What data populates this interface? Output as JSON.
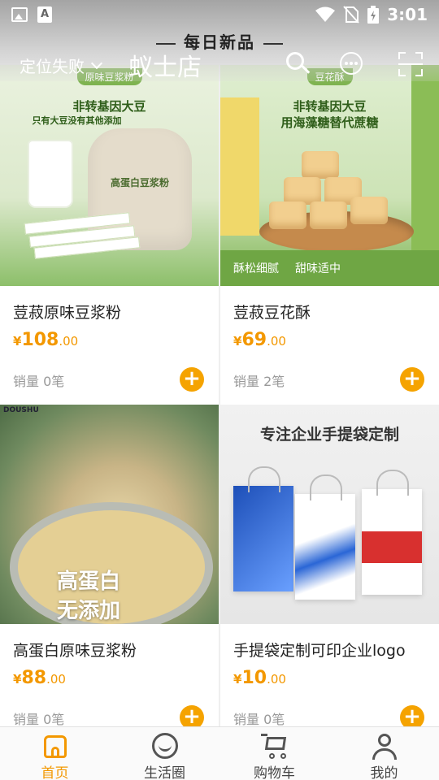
{
  "status_bar": {
    "time": "3:01",
    "a_badge": "A",
    "icons": [
      "image-icon",
      "a-badge-icon",
      "wifi-icon",
      "no-sim-icon",
      "battery-charging-icon"
    ]
  },
  "header": {
    "title": "每日新品",
    "location": "定位失败",
    "shop_name": "蚁士店"
  },
  "products": [
    {
      "name": "荳菽原味豆浆粉",
      "price_symbol": "¥",
      "price_int": "108",
      "price_dec": ".00",
      "sales": "销量 0笔",
      "image_text": {
        "tag": "原味豆浆粉",
        "line1": "非转基因大豆",
        "line2": "只有大豆没有其他添加",
        "bag_label": "高蛋白豆浆粉"
      }
    },
    {
      "name": "荳菽豆花酥",
      "price_symbol": "¥",
      "price_int": "69",
      "price_dec": ".00",
      "sales": "销量 2笔",
      "image_text": {
        "tag": "豆花酥",
        "line1": "非转基因大豆",
        "line2": "用海藻糖替代蔗糖",
        "bottom_left": "酥松细腻",
        "bottom_right": "甜味适中"
      }
    },
    {
      "name": "高蛋白原味豆浆粉",
      "price_symbol": "¥",
      "price_int": "88",
      "price_dec": ".00",
      "sales": "销量 0笔",
      "image_text": {
        "brand": "DOUSHU",
        "line1": "高蛋白",
        "line2": "无添加"
      }
    },
    {
      "name": "手提袋定制可印企业logo",
      "price_symbol": "¥",
      "price_int": "10",
      "price_dec": ".00",
      "sales": "销量 0笔",
      "image_text": {
        "headline": "专注企业手提袋定制"
      }
    }
  ],
  "add_button_label": "+",
  "bottom_nav": [
    {
      "label": "首页",
      "icon": "home-icon",
      "active": true
    },
    {
      "label": "生活圈",
      "icon": "chat-circle-icon",
      "active": false
    },
    {
      "label": "购物车",
      "icon": "cart-icon",
      "active": false
    },
    {
      "label": "我的",
      "icon": "user-icon",
      "active": false
    }
  ],
  "colors": {
    "accent": "#f39800",
    "add_button": "#f5a300",
    "price": "#f39800"
  }
}
